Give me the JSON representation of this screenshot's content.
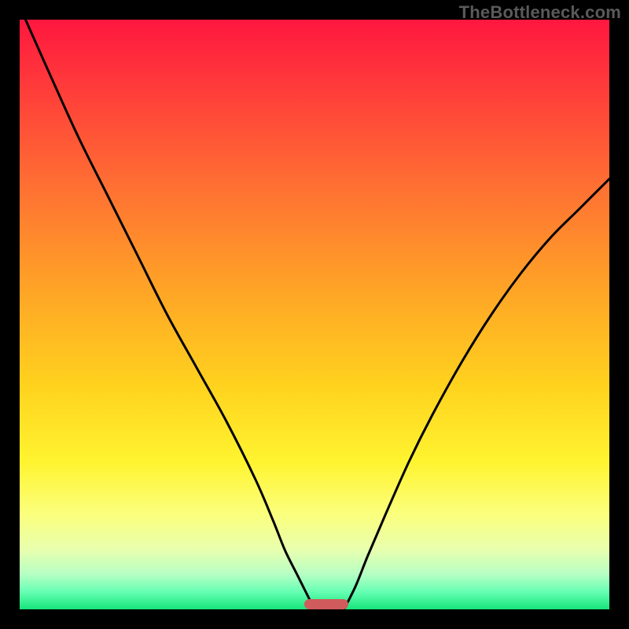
{
  "watermark": "TheBottleneck.com",
  "chart_data": {
    "type": "line",
    "title": "",
    "xlabel": "",
    "ylabel": "",
    "xlim": [
      0,
      100
    ],
    "ylim": [
      0,
      100
    ],
    "grid": false,
    "legend": false,
    "background_gradient_stops": [
      {
        "offset": 0.0,
        "color": "#ff173f"
      },
      {
        "offset": 0.12,
        "color": "#ff3d3a"
      },
      {
        "offset": 0.28,
        "color": "#ff6f33"
      },
      {
        "offset": 0.45,
        "color": "#ffa227"
      },
      {
        "offset": 0.62,
        "color": "#ffd21e"
      },
      {
        "offset": 0.75,
        "color": "#fff430"
      },
      {
        "offset": 0.84,
        "color": "#fbff7e"
      },
      {
        "offset": 0.9,
        "color": "#e7ffaf"
      },
      {
        "offset": 0.94,
        "color": "#b7ffc4"
      },
      {
        "offset": 0.97,
        "color": "#67ffb4"
      },
      {
        "offset": 1.0,
        "color": "#16e57a"
      }
    ],
    "series": [
      {
        "name": "left-curve",
        "x": [
          1,
          5,
          10,
          15,
          20,
          25,
          30,
          35,
          40,
          43,
          45,
          47,
          49,
          50
        ],
        "y": [
          100,
          91,
          80,
          70,
          60,
          50,
          41,
          32,
          22,
          15,
          10,
          6,
          2,
          0
        ]
      },
      {
        "name": "right-curve",
        "x": [
          55,
          57,
          59,
          62,
          66,
          70,
          75,
          80,
          85,
          90,
          95,
          100
        ],
        "y": [
          0,
          4,
          9,
          16,
          25,
          33,
          42,
          50,
          57,
          63,
          68,
          73
        ]
      }
    ],
    "marker": {
      "name": "bottleneck-marker",
      "x_center": 52,
      "width_pct": 7.5,
      "height_pct": 1.8,
      "color": "#cf5b5c"
    }
  }
}
